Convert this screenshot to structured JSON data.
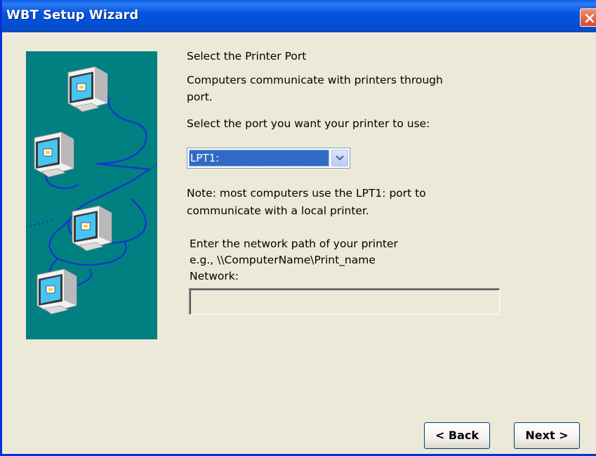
{
  "window": {
    "title": "WBT Setup Wizard"
  },
  "content": {
    "heading": "Select the Printer Port",
    "description_line1": "Computers communicate with printers through",
    "description_line2": "port.",
    "select_prompt": "Select the port you want your printer to use:",
    "port_selected": "LPT1:",
    "note_line1": "Note: most computers use the LPT1: port to",
    "note_line2": "communicate with a local printer.",
    "network_hint_line1": "Enter the network path of your printer",
    "network_hint_line2": "e.g., \\\\ComputerName\\Print_name",
    "network_label": "Network:",
    "network_value": ""
  },
  "buttons": {
    "back": "< Back",
    "next": "Next >"
  },
  "icons": {
    "close": "close-icon",
    "dropdown": "chevron-down-icon",
    "illustration": "networked-computers-illustration"
  },
  "colors": {
    "titlebar": "#0054e3",
    "illustration_bg": "#008080",
    "network_line": "#1c2bd9",
    "selection": "#316ac5",
    "close_button": "#d6462a"
  }
}
